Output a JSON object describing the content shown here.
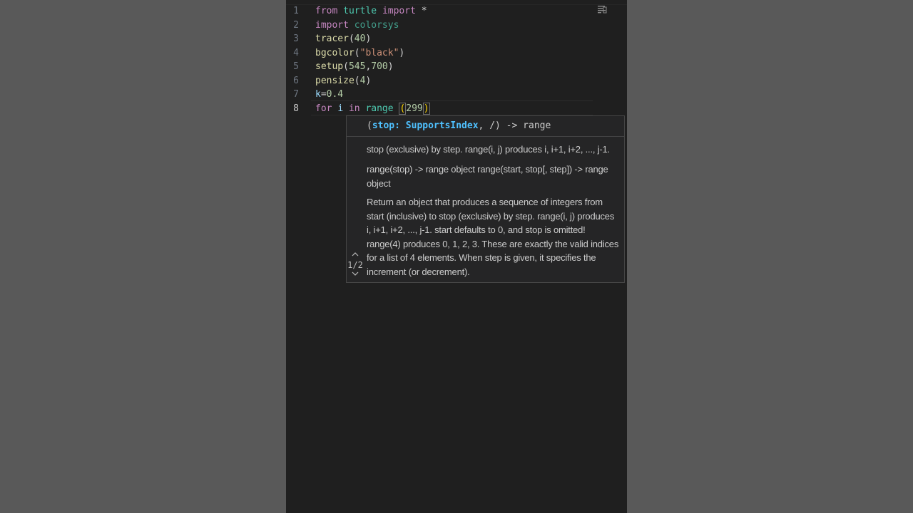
{
  "editor": {
    "lines": [
      {
        "num": "1",
        "tokens": [
          [
            "kw",
            "from"
          ],
          [
            "punc",
            " "
          ],
          [
            "mod",
            "turtle"
          ],
          [
            "punc",
            " "
          ],
          [
            "kw",
            "import"
          ],
          [
            "punc",
            " *"
          ]
        ]
      },
      {
        "num": "2",
        "tokens": [
          [
            "kw",
            "import"
          ],
          [
            "punc",
            " "
          ],
          [
            "mod2",
            "colorsys"
          ]
        ]
      },
      {
        "num": "3",
        "tokens": [
          [
            "fn",
            "tracer"
          ],
          [
            "punc",
            "("
          ],
          [
            "num",
            "40"
          ],
          [
            "punc",
            ")"
          ]
        ]
      },
      {
        "num": "4",
        "tokens": [
          [
            "fn",
            "bgcolor"
          ],
          [
            "punc",
            "("
          ],
          [
            "str",
            "\"black\""
          ],
          [
            "punc",
            ")"
          ]
        ]
      },
      {
        "num": "5",
        "tokens": [
          [
            "fn",
            "setup"
          ],
          [
            "punc",
            "("
          ],
          [
            "num",
            "545"
          ],
          [
            "punc",
            ","
          ],
          [
            "num",
            "700"
          ],
          [
            "punc",
            ")"
          ]
        ]
      },
      {
        "num": "6",
        "tokens": [
          [
            "fn",
            "pensize"
          ],
          [
            "punc",
            "("
          ],
          [
            "num",
            "4"
          ],
          [
            "punc",
            ")"
          ]
        ]
      },
      {
        "num": "7",
        "tokens": [
          [
            "var",
            "k"
          ],
          [
            "punc",
            "="
          ],
          [
            "num",
            "0.4"
          ]
        ]
      },
      {
        "num": "8",
        "tokens": [
          [
            "kw",
            "for"
          ],
          [
            "punc",
            " "
          ],
          [
            "var",
            "i"
          ],
          [
            "punc",
            " "
          ],
          [
            "kw",
            "in"
          ],
          [
            "punc",
            " "
          ],
          [
            "mod",
            "range"
          ],
          [
            "punc",
            " "
          ],
          [
            "paren",
            "("
          ],
          [
            "num",
            "299"
          ],
          [
            "paren",
            ")"
          ]
        ]
      }
    ],
    "active_line": 8
  },
  "signature_help": {
    "open_paren": "(",
    "param": "stop: SupportsIndex",
    "rest": ", /) -> range",
    "pager": {
      "up": "^",
      "count": "1/2",
      "down": "v"
    },
    "doc_para1": "stop (exclusive) by step.  range(i, j) produces i, i+1, i+2, ..., j-1.",
    "doc_para2": "range(stop) -> range object range(start, stop[, step]) -> range object",
    "doc_para3": "Return an object that produces a sequence of integers from start (inclusive) to stop (exclusive) by step. range(i, j) produces i, i+1, i+2, ..., j-1. start defaults to 0, and stop is omitted! range(4) produces 0, 1, 2, 3. These are exactly the valid indices for a list of 4 elements. When step is given, it specifies the increment (or decrement)."
  },
  "colors": {
    "editor_bg": "#1f1f1f",
    "page_bg": "#5b5b5b",
    "keyword": "#c586c0",
    "module": "#4ec9b0",
    "function": "#dcdcaa",
    "string": "#ce9178",
    "number": "#b5cea8",
    "param": "#4fc1ff"
  },
  "icons": {
    "minimap": "minimap-toggle-icon"
  }
}
